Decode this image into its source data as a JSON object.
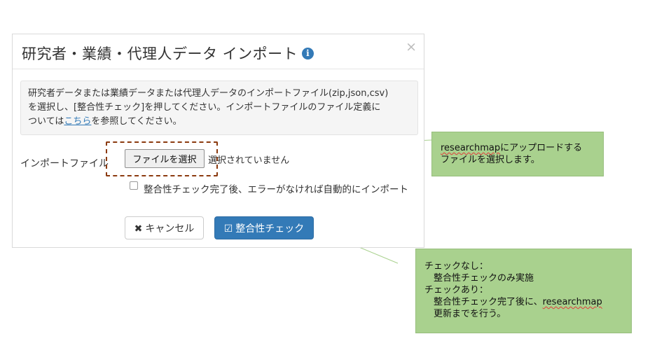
{
  "modal": {
    "title": "研究者・業績・代理人データ インポート",
    "info_icon": "i",
    "close_icon": "×",
    "notice": {
      "line1": "研究者データまたは業績データまたは代理人データのインポートファイル(zip,json,csv)",
      "line2": "を選択し、[整合性チェック]を押してください。インポートファイルのファイル定義に",
      "line3_before": "ついては",
      "line3_link": "こちら",
      "line3_after": "を参照してください。"
    },
    "import_file_label": "インポートファイル",
    "file_button_label": "ファイルを選択",
    "file_status": "選択されていません",
    "auto_import_label": "整合性チェック完了後、エラーがなければ自動的にインポート",
    "auto_import_checked": false,
    "cancel_button": {
      "icon": "✖",
      "label": "キャンセル"
    },
    "check_button": {
      "icon": "☑",
      "label": "整合性チェック"
    }
  },
  "callouts": {
    "file_select": {
      "line1_squiggle": "researchmap",
      "line1_rest": "にアップロードする",
      "line2": "ファイルを選択します。"
    },
    "check_note": {
      "line1": "チェックなし：",
      "line2": "整合性チェックのみ実施",
      "line3": "チェックあり：",
      "line4_before": "整合性チェック完了後に、",
      "line4_squiggle": "researchmap",
      "line5": "更新までを行う。"
    }
  },
  "colors": {
    "primary": "#337ab7",
    "callout_bg": "#a9d18e",
    "dashed_border": "#8b3a0f"
  }
}
